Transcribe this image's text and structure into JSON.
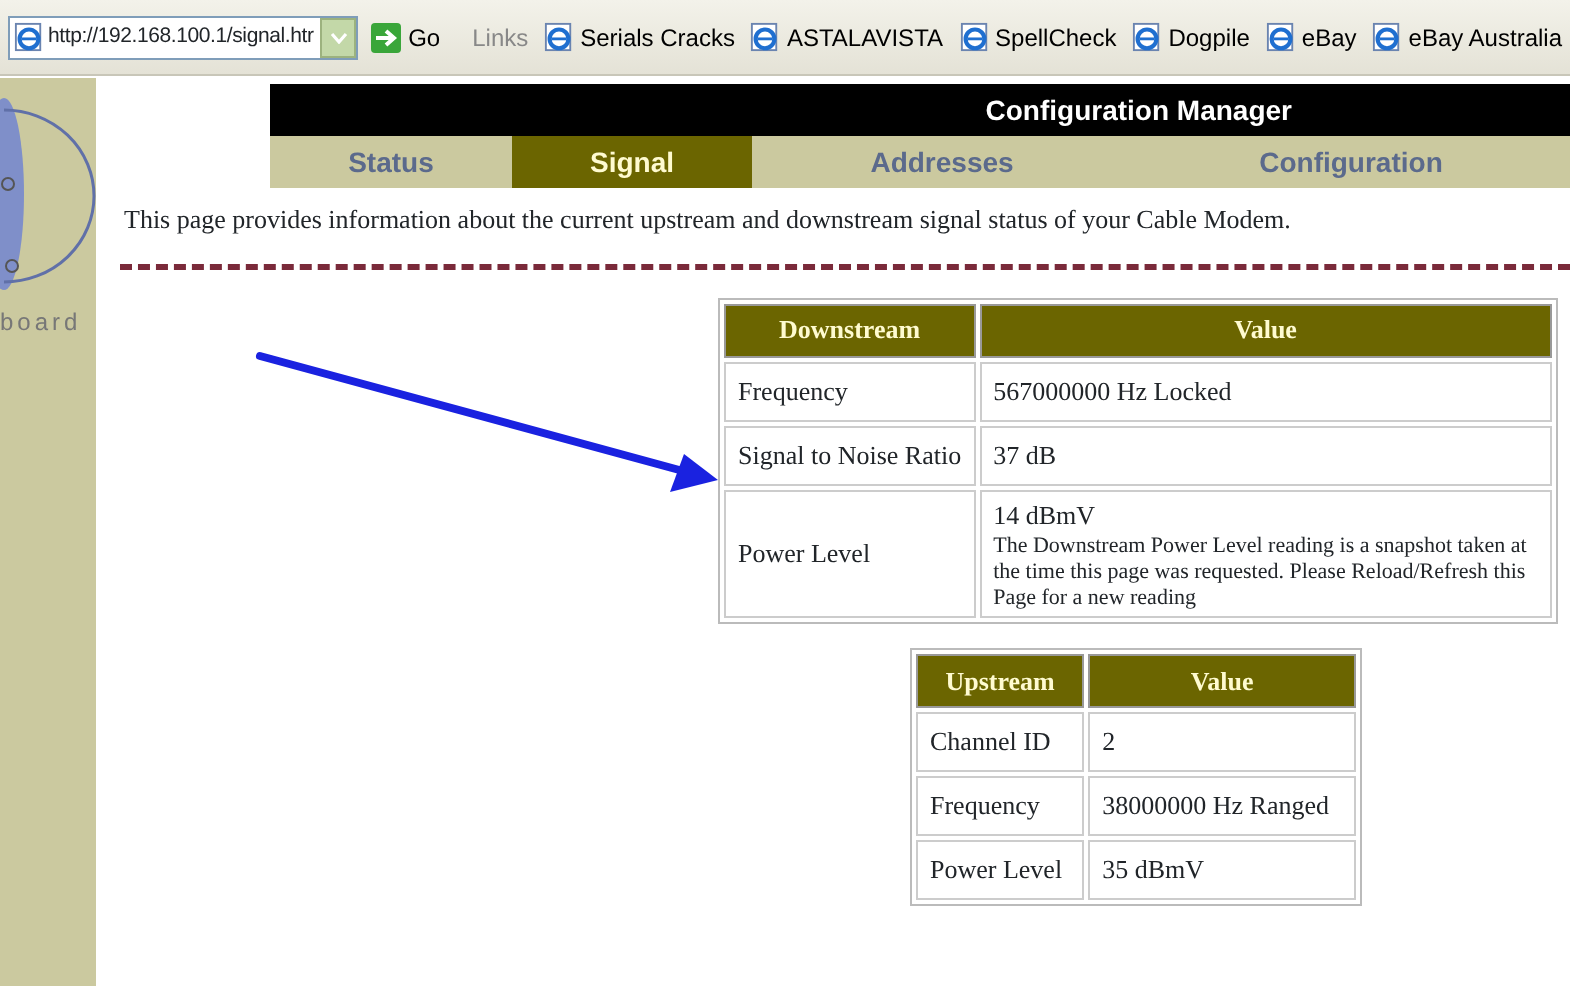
{
  "toolbar": {
    "address": "http://192.168.100.1/signal.htr",
    "go": "Go",
    "links_label": "Links",
    "links": [
      "Serials Cracks",
      "ASTALAVISTA",
      "SpellCheck",
      "Dogpile",
      "eBay",
      "eBay Australia"
    ]
  },
  "logo": {
    "text": "board"
  },
  "header": {
    "title": "Configuration Manager"
  },
  "tabs": [
    {
      "label": "Status",
      "selected": false
    },
    {
      "label": "Signal",
      "selected": true
    },
    {
      "label": "Addresses",
      "selected": false
    },
    {
      "label": "Configuration",
      "selected": false
    }
  ],
  "description": "This page provides information about the current upstream and downstream signal status of your Cable Modem.",
  "tables": [
    {
      "columns": [
        "Downstream",
        "Value"
      ],
      "rows": [
        {
          "cells": [
            "Frequency",
            "567000000 Hz Locked"
          ]
        },
        {
          "cells": [
            "Signal to Noise Ratio",
            "37 dB"
          ]
        },
        {
          "cells": [
            "Power Level",
            "14 dBmV"
          ],
          "note": "The Downstream Power Level reading is a snapshot taken at the time this page was requested. Please Reload/Refresh this Page for a new reading"
        }
      ]
    },
    {
      "columns": [
        "Upstream",
        "Value"
      ],
      "rows": [
        {
          "cells": [
            "Channel ID",
            "2"
          ]
        },
        {
          "cells": [
            "Frequency",
            "38000000 Hz Ranged"
          ]
        },
        {
          "cells": [
            "Power Level",
            "35 dBmV"
          ]
        }
      ]
    }
  ]
}
